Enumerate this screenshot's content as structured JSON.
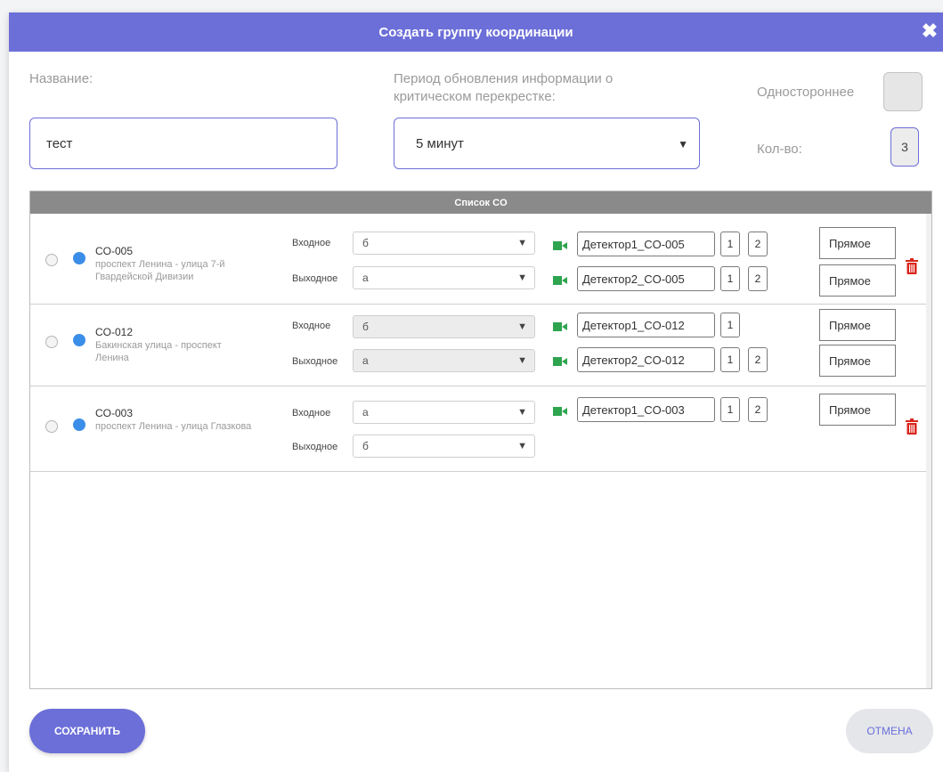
{
  "dialog": {
    "title": "Создать группу координации",
    "close_glyph": "✖"
  },
  "form": {
    "name_label": "Название:",
    "name_value": "тест",
    "period_label": "Период обновления информации о критическом перекрестке:",
    "period_value": "5 минут",
    "one_way_label": "Одностороннее",
    "count_label": "Кол-во:",
    "count_value": "3"
  },
  "list": {
    "header": "Список CO",
    "in_label": "Входное",
    "out_label": "Выходное",
    "items": [
      {
        "code": "CO-005",
        "address": "проспект Ленина - улица 7-й Гвардейской Дивизии",
        "in_value": "б",
        "out_value": "а",
        "detectors": [
          {
            "name": "Детектор1_CO-005",
            "nums": [
              "1",
              "2"
            ],
            "dir": "Прямое"
          },
          {
            "name": "Детектор2_CO-005",
            "nums": [
              "1",
              "2"
            ],
            "dir": "Прямое"
          }
        ]
      },
      {
        "code": "CO-012",
        "address": "Бакинская улица - проспект Ленина",
        "in_value": "б",
        "out_value": "а",
        "detectors": [
          {
            "name": "Детектор1_CO-012",
            "nums": [
              "1"
            ],
            "dir": "Прямое"
          },
          {
            "name": "Детектор2_CO-012",
            "nums": [
              "1",
              "2"
            ],
            "dir": "Прямое"
          }
        ]
      },
      {
        "code": "CO-003",
        "address": "проспект Ленина - улица Глазкова",
        "in_value": "а",
        "out_value": "б",
        "detectors": [
          {
            "name": "Детектор1_CO-003",
            "nums": [
              "1",
              "2"
            ],
            "dir": "Прямое"
          }
        ]
      }
    ]
  },
  "buttons": {
    "save": "СОХРАНИТЬ",
    "cancel": "ОТМЕНА"
  },
  "colors": {
    "accent": "#6c6fd8",
    "status_dot": "#3b8ee8",
    "camera": "#2ea44f",
    "trash": "#d9251c"
  },
  "icons": {
    "close": "close-icon",
    "camera": "video-camera-icon",
    "trash": "trash-icon",
    "dropdown": "chevron-down-icon"
  }
}
